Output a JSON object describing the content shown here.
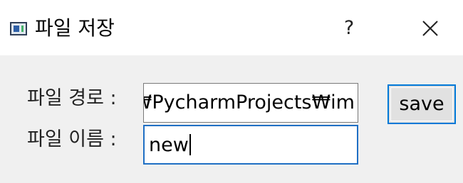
{
  "window": {
    "title": "파일 저장",
    "help_label": "?",
    "icons": {
      "app": "app-window-icon",
      "close": "close-icon"
    }
  },
  "form": {
    "path_label": "파일 경로 :",
    "path_value": "₩PycharmProjects₩im",
    "name_label": "파일 이름 :",
    "name_value": "new",
    "save_label": "save"
  },
  "colors": {
    "focus_border": "#1f6fc4",
    "button_border": "#0078d7",
    "background": "#f0f0f0"
  }
}
